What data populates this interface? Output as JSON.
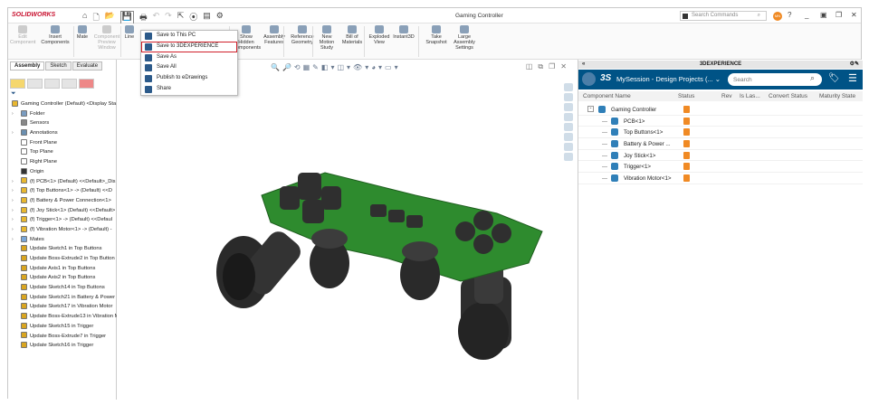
{
  "app": {
    "logo": "SOLIDWORKS",
    "document_title": "Gaming Controller",
    "search_placeholder": "Search Commands",
    "user_initials": "MN"
  },
  "save_menu": [
    "Save to This PC",
    "Save to 3DEXPERIENCE",
    "Save As",
    "Save All",
    "Publish to eDrawings",
    "Share"
  ],
  "ribbon": [
    {
      "label": "Edit Component",
      "enabled": false
    },
    {
      "label": "Insert Components",
      "enabled": true
    },
    {
      "label": "Mate",
      "enabled": true
    },
    {
      "label": "Component Preview Window",
      "enabled": false
    },
    {
      "label": "Line",
      "enabled": true
    },
    {
      "label": "Show Hidden Components",
      "enabled": true
    },
    {
      "label": "Assembly Features",
      "enabled": true
    },
    {
      "label": "Reference Geometry",
      "enabled": true
    },
    {
      "label": "New Motion Study",
      "enabled": true
    },
    {
      "label": "Bill of Materials",
      "enabled": true
    },
    {
      "label": "Exploded View",
      "enabled": true
    },
    {
      "label": "Instant3D",
      "enabled": true
    },
    {
      "label": "Take Snapshot",
      "enabled": true
    },
    {
      "label": "Large Assembly Settings",
      "enabled": true
    }
  ],
  "left_tabs": [
    "Assembly",
    "Sketch",
    "Evaluate"
  ],
  "tree": [
    {
      "label": "Gaming Controller (Default) <Display Sta",
      "level": 0,
      "icon": "assembly"
    },
    {
      "label": "Folder",
      "level": 1,
      "arrow": true,
      "icon": "folder"
    },
    {
      "label": "Sensors",
      "level": 1,
      "icon": "sensor"
    },
    {
      "label": "Annotations",
      "level": 1,
      "arrow": true,
      "icon": "annotation"
    },
    {
      "label": "Front Plane",
      "level": 1,
      "icon": "plane"
    },
    {
      "label": "Top Plane",
      "level": 1,
      "icon": "plane"
    },
    {
      "label": "Right Plane",
      "level": 1,
      "icon": "plane"
    },
    {
      "label": "Origin",
      "level": 1,
      "icon": "origin"
    },
    {
      "label": "(f) PCB<1> (Default) <<Default>_Dis",
      "level": 1,
      "arrow": true,
      "icon": "part"
    },
    {
      "label": "(f) Top Buttons<1> -> (Default) <<D",
      "level": 1,
      "arrow": true,
      "icon": "part"
    },
    {
      "label": "(f) Battery & Power Connection<1>",
      "level": 1,
      "arrow": true,
      "icon": "part"
    },
    {
      "label": "(f) Joy Stick<1> (Default) <<Default>",
      "level": 1,
      "arrow": true,
      "icon": "part"
    },
    {
      "label": "(f) Trigger<1> -> (Default) <<Defaul",
      "level": 1,
      "arrow": true,
      "icon": "part"
    },
    {
      "label": "(f) Vibration Motor<1> -> (Default) -",
      "level": 1,
      "arrow": true,
      "icon": "part"
    },
    {
      "label": "Mates",
      "level": 1,
      "arrow": true,
      "icon": "mates"
    },
    {
      "label": "Update Sketch1 in Top Buttons",
      "level": 1,
      "icon": "update"
    },
    {
      "label": "Update Boss-Extrude2 in Top Button",
      "level": 1,
      "icon": "update"
    },
    {
      "label": "Update Axis1 in Top Buttons",
      "level": 1,
      "icon": "update"
    },
    {
      "label": "Update Axis2 in Top Buttons",
      "level": 1,
      "icon": "update"
    },
    {
      "label": "Update Sketch14 in Top Buttons",
      "level": 1,
      "icon": "update"
    },
    {
      "label": "Update Sketch21 in Battery & Power",
      "level": 1,
      "icon": "update"
    },
    {
      "label": "Update Sketch17 in Vibration Motor",
      "level": 1,
      "icon": "update"
    },
    {
      "label": "Update Boss-Extrude13 in Vibration M",
      "level": 1,
      "icon": "update"
    },
    {
      "label": "Update Sketch15 in Trigger",
      "level": 1,
      "icon": "update"
    },
    {
      "label": "Update Boss-Extrude7 in Trigger",
      "level": 1,
      "icon": "update"
    },
    {
      "label": "Update Sketch16 in Trigger",
      "level": 1,
      "icon": "update"
    }
  ],
  "panel": {
    "title": "3DEXPERIENCE",
    "session": "MySession - Design Projects (...",
    "search_placeholder": "Search",
    "columns": [
      "Component Name",
      "Status",
      "Rev",
      "Is Las...",
      "Convert Status",
      "Maturity State"
    ],
    "components": [
      {
        "name": "Gaming Controller",
        "root": true
      },
      {
        "name": "PCB<1>"
      },
      {
        "name": "Top Buttons<1>"
      },
      {
        "name": "Battery & Power ..."
      },
      {
        "name": "Joy Stick<1>"
      },
      {
        "name": "Trigger<1>"
      },
      {
        "name": "Vibration Motor<1>"
      }
    ]
  },
  "colors": {
    "brand_red": "#c8102e",
    "ds_blue": "#005386",
    "pcb_green": "#2e8b2e",
    "status_orange": "#f08a24"
  }
}
